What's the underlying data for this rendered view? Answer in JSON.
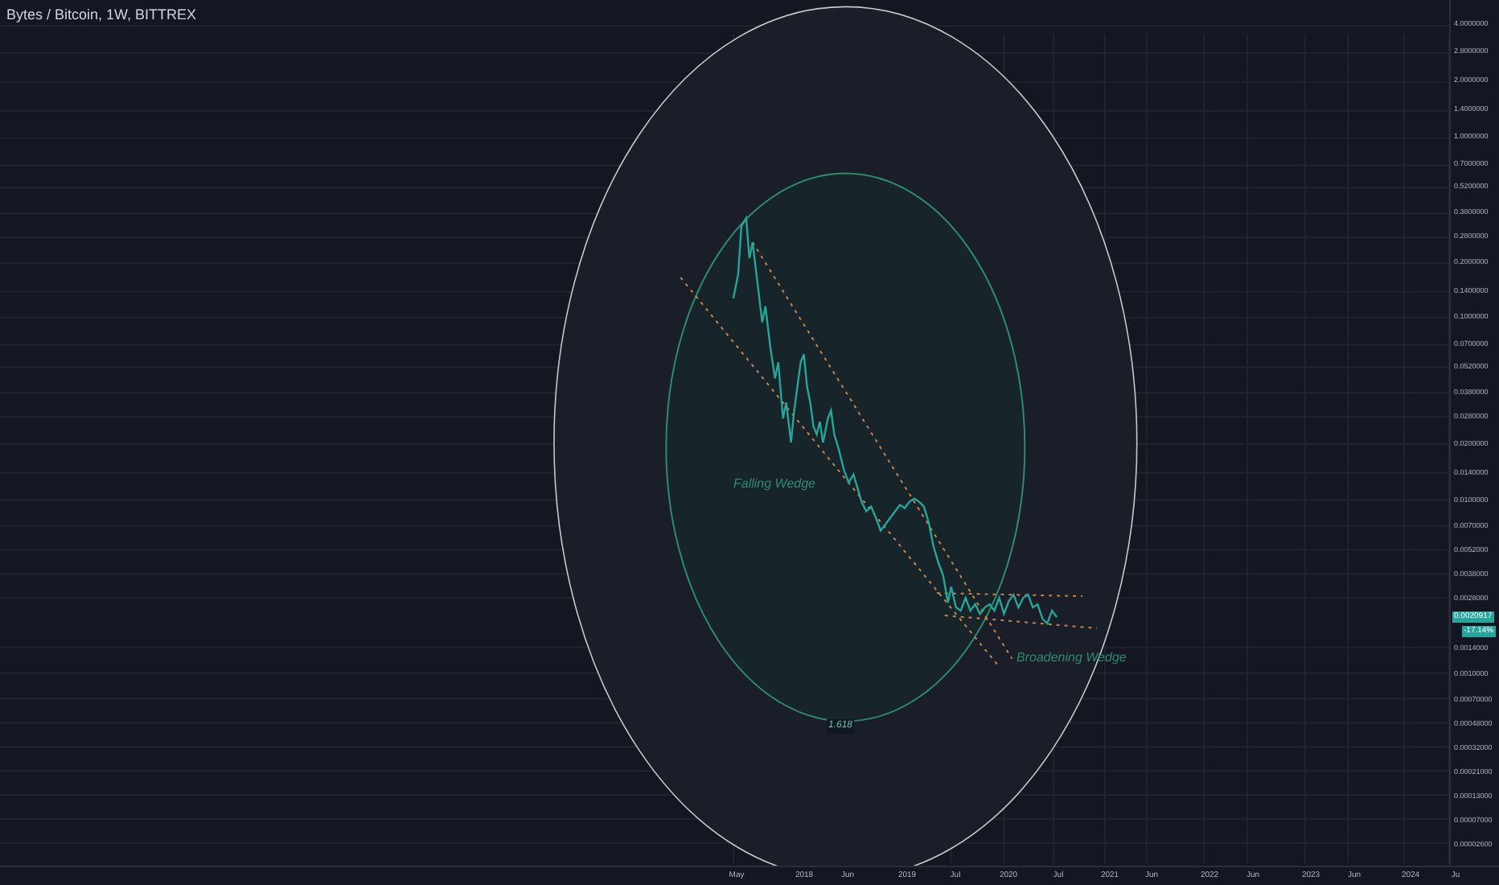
{
  "title": "Bytes / Bitcoin, 1W, BITTREX",
  "price_axis": [
    "4.0000000",
    "2.8000000",
    "2.0000000",
    "1.4000000",
    "1.0000000",
    "0.7000000",
    "0.5200000",
    "0.3800000",
    "0.2800000",
    "0.2000000",
    "0.1400000",
    "0.1000000",
    "0.0700000",
    "0.0520000",
    "0.0380000",
    "0.0280000",
    "0.0200000",
    "0.0140000",
    "0.0100000",
    "0.0070000",
    "0.0052000",
    "0.0038000",
    "0.0028000",
    "0.0014000",
    "0.0010000",
    "0.00070000",
    "0.00048000",
    "0.00032000",
    "0.00021000",
    "0.00013000",
    "0.00007000",
    "0.00002600"
  ],
  "price_tag": "0.0020917",
  "change_tag": "-17.14%",
  "time_axis": [
    "May",
    "2018",
    "Jun",
    "2019",
    "Jul",
    "2020",
    "Jul",
    "2021",
    "Jun",
    "2022",
    "Jun",
    "2023",
    "Jun",
    "2024",
    "Ju"
  ],
  "annotations": [
    {
      "text": "Falling Wedge"
    },
    {
      "text": "Broadening Wedge"
    },
    {
      "text": "1.618"
    }
  ]
}
